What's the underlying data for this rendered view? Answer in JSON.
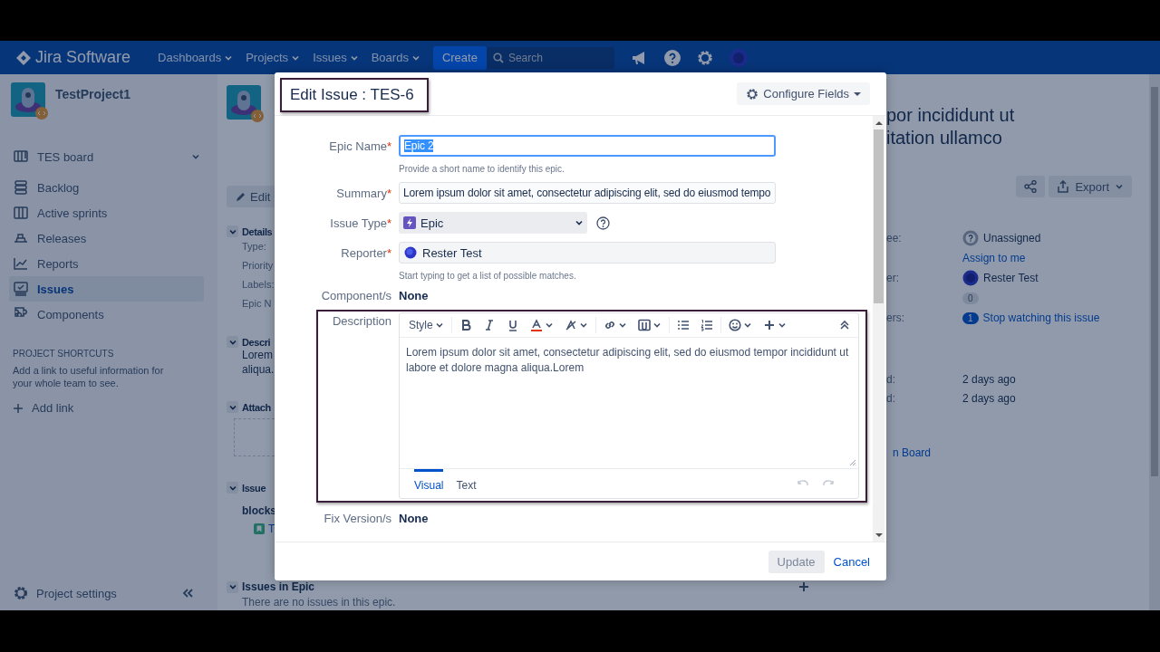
{
  "top_nav": {
    "logo": "Jira Software",
    "menus": [
      {
        "label": "Dashboards"
      },
      {
        "label": "Projects"
      },
      {
        "label": "Issues"
      },
      {
        "label": "Boards"
      }
    ],
    "create": "Create",
    "search": {
      "placeholder": "Search"
    }
  },
  "sidebar": {
    "project": "TestProject1",
    "board": "TES board",
    "items": [
      {
        "label": "Backlog",
        "selected": false
      },
      {
        "label": "Active sprints",
        "selected": false
      },
      {
        "label": "Releases",
        "selected": false
      },
      {
        "label": "Reports",
        "selected": false
      },
      {
        "label": "Issues",
        "selected": true
      },
      {
        "label": "Components",
        "selected": false
      }
    ],
    "shortcuts_heading": "PROJECT SHORTCUTS",
    "shortcuts_text": "Add a link to useful information for your whole team to see.",
    "add_link": "Add link",
    "settings": "Project settings"
  },
  "issue_page": {
    "edit": "Edit",
    "details": {
      "heading": "Details",
      "labels": [
        "Type:",
        "Priority",
        "Labels:",
        "Epic N"
      ]
    },
    "description": {
      "heading": "Descri",
      "lines": [
        "Lorem",
        "aliqua."
      ]
    },
    "attachments": {
      "heading": "Attach"
    },
    "links": {
      "heading": "Issue",
      "type": "blocks",
      "issue": "T"
    },
    "epic": {
      "heading": "Issues in Epic",
      "empty": "There are no issues in this epic."
    },
    "title_lines": [
      "por incididunt ut",
      "itation ullamco"
    ],
    "export": "Export",
    "people": [
      {
        "kind": "unassigned",
        "label": "ee:",
        "value": "Unassigned"
      },
      {
        "kind": "link",
        "value": "Assign to me"
      },
      {
        "kind": "user",
        "label": "er:",
        "value": "Rester Test"
      },
      {
        "kind": "count",
        "value": "0"
      },
      {
        "kind": "watch",
        "label": "ers:",
        "count": "1",
        "value": "Stop watching this issue"
      }
    ],
    "dates": [
      {
        "label": "d:",
        "value": "2 days ago"
      },
      {
        "label": "d:",
        "value": "2 days ago"
      }
    ],
    "board_link": "n Board"
  },
  "dialog": {
    "title": "Edit Issue : TES-6",
    "configure": "Configure Fields",
    "fields": [
      {
        "kind": "text",
        "label": "Epic Name",
        "marker": "*",
        "value": "Epic 2",
        "focused": true,
        "text_selected": true,
        "hint": "Provide a short name to identify this epic."
      },
      {
        "kind": "text",
        "label": "Summary",
        "marker": "*",
        "value": "Lorem ipsum dolor sit amet, consectetur adipiscing elit, sed do eiusmod tempo",
        "focused": false,
        "text_selected": false
      },
      {
        "kind": "select",
        "label": "Issue Type",
        "marker": "*",
        "value": "Epic"
      },
      {
        "kind": "user",
        "label": "Reporter",
        "marker": "*",
        "value": "Rester Test",
        "hint": "Start typing to get a list of possible matches."
      },
      {
        "kind": "static",
        "label": "Component/s",
        "value": "None"
      },
      {
        "kind": "editor",
        "label": "Description",
        "style": "Style",
        "text": "Lorem ipsum dolor sit amet, consectetur adipiscing elit, sed do eiusmod tempor incididunt ut labore et dolore magna aliqua.Lorem",
        "tabs": [
          {
            "label": "Visual",
            "selected": true
          },
          {
            "label": "Text",
            "selected": false
          }
        ]
      },
      {
        "kind": "static",
        "label": "Fix Version/s",
        "value": "None"
      }
    ],
    "buttons": {
      "update": "Update",
      "cancel": "Cancel"
    }
  }
}
